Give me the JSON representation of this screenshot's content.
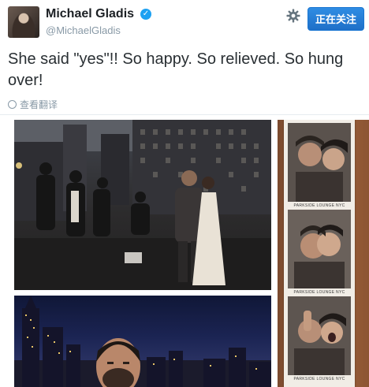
{
  "header": {
    "display_name": "Michael Gladis",
    "handle": "@MichaelGladis",
    "verified_mark": "✓",
    "follow_label": "正在关注"
  },
  "tweet": {
    "text": "She said \"yes\"!! So happy. So relieved. So hung over!",
    "translate_label": "查看翻译"
  },
  "photo_strip": {
    "label_1": "PARKSIDE LOUNGE NYC",
    "label_2": "PARKSIDE LOUNGE NYC",
    "label_3": "PARKSIDE LOUNGE NYC"
  },
  "colors": {
    "accent": "#1da1f2",
    "follow_button": "#1e6fc8",
    "muted_text": "#8899a6"
  },
  "icons": [
    "settings-gear-icon",
    "verified-badge-icon",
    "translate-icon"
  ]
}
